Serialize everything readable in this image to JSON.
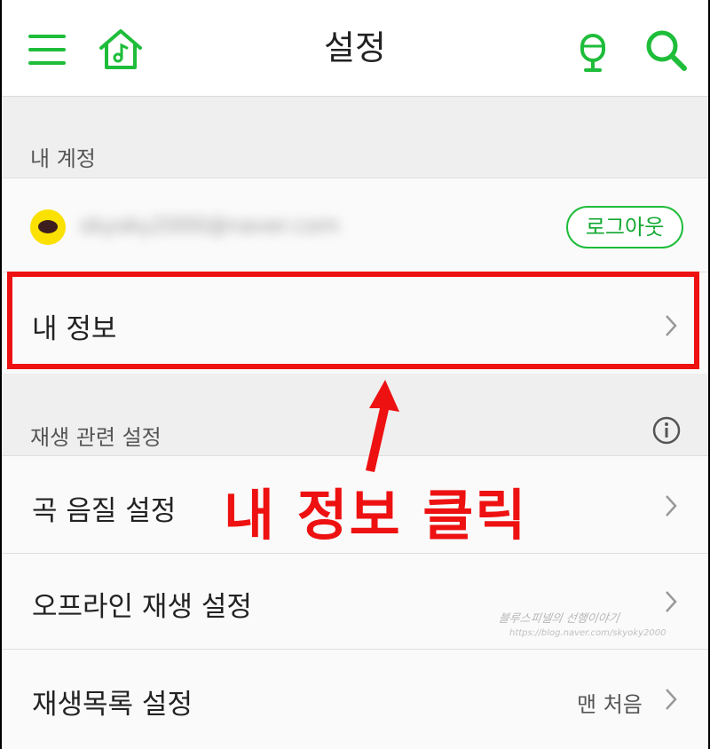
{
  "colors": {
    "accent": "#1ebd3a",
    "annotation_red": "#ee1111",
    "kakao_yellow": "#fae100"
  },
  "header": {
    "title": "설정",
    "icons": [
      "menu-icon",
      "home-music-icon",
      "microphone-icon",
      "search-icon"
    ]
  },
  "account_section": {
    "title": "내 계정",
    "email": "skyoky2000@naver.com",
    "logout_label": "로그아웃",
    "my_info_label": "내 정보"
  },
  "playback_section": {
    "title": "재생 관련 설정",
    "items": [
      {
        "label": "곡 음질 설정"
      },
      {
        "label": "오프라인 재생 설정"
      },
      {
        "label": "재생목록 설정",
        "value": "맨 처음"
      }
    ]
  },
  "annotation": {
    "text": "내 정보 클릭"
  },
  "watermark": {
    "line1": "블루스피넬의 선행이야기",
    "line2": "https://blog.naver.com/skyoky2000"
  }
}
